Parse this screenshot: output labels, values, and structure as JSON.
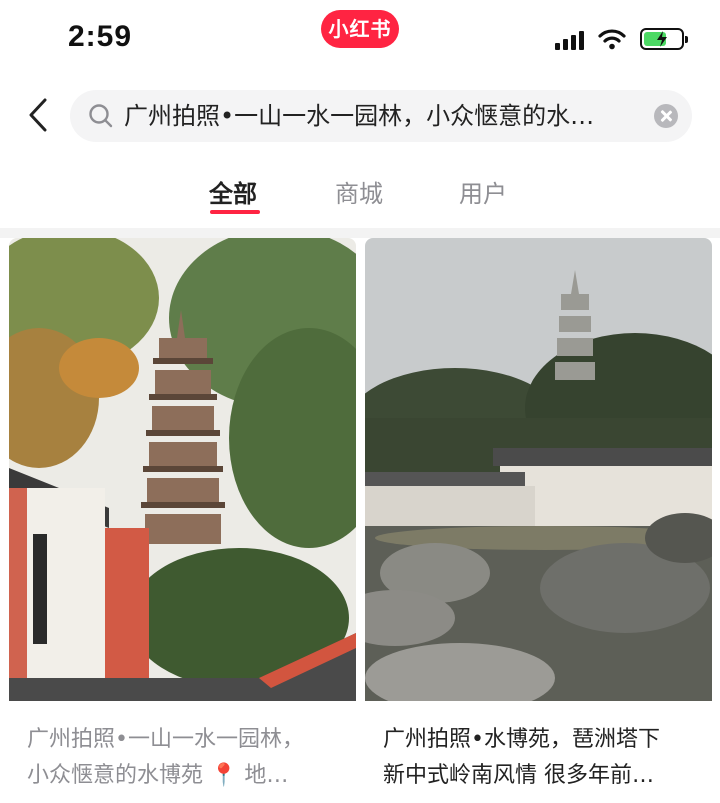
{
  "status_bar": {
    "time": "2:59",
    "app_badge": "小红书"
  },
  "search": {
    "query": "广州拍照•一山一水一园林，小众惬意的水…"
  },
  "tabs": [
    {
      "label": "全部",
      "active": true
    },
    {
      "label": "商城",
      "active": false
    },
    {
      "label": "用户",
      "active": false
    }
  ],
  "notes": [
    {
      "title_line1": "广州拍照•一山一水一园林，",
      "title_line2": "小众惬意的水博苑 📍 地…"
    },
    {
      "title_line1": "广州拍照•水博苑，琶洲塔下",
      "title_line2": "新中式岭南风情 很多年前…"
    }
  ],
  "colors": {
    "brand": "#ff2442",
    "tab_inactive": "#8e8e93",
    "battery": "#4cd964"
  },
  "status": {
    "battery_level": 0.6
  },
  "icons": [
    "signal-icon",
    "wifi-icon",
    "battery-icon",
    "back-icon",
    "search-icon",
    "clear-icon"
  ]
}
